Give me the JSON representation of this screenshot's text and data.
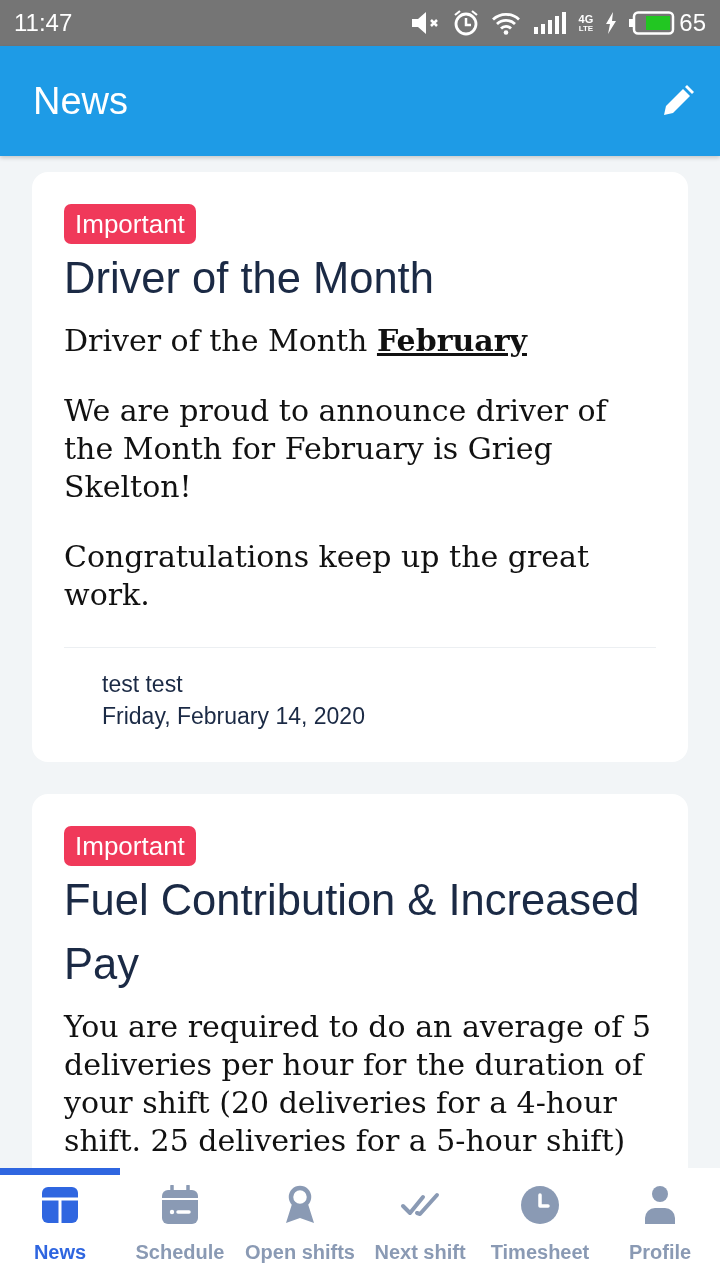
{
  "status_bar": {
    "time": "11:47",
    "network": "4G",
    "network_sub": "LTE",
    "battery_percent": "65"
  },
  "app_bar": {
    "title": "News"
  },
  "posts": [
    {
      "badge": "Important",
      "title": "Driver of the Month",
      "paragraphs": [
        "Driver of the Month **February**",
        "We are proud to announce driver of the Month for February is Grieg Skelton!",
        "Congratulations keep up the great work."
      ],
      "author": "test test",
      "date": "Friday, February 14, 2020"
    },
    {
      "badge": "Important",
      "title": "Fuel Contribution & Increased Pay",
      "paragraphs": [
        "You are required to do an average of 5 deliveries per hour for the duration of your shift (20 deliveries for a 4-hour shift. 25 deliveries for a 5-hour shift)"
      ]
    }
  ],
  "bottom_nav": [
    {
      "label": "News",
      "selected": true
    },
    {
      "label": "Schedule",
      "selected": false
    },
    {
      "label": "Open shifts",
      "selected": false
    },
    {
      "label": "Next shift",
      "selected": false
    },
    {
      "label": "Timesheet",
      "selected": false
    },
    {
      "label": "Profile",
      "selected": false
    }
  ]
}
